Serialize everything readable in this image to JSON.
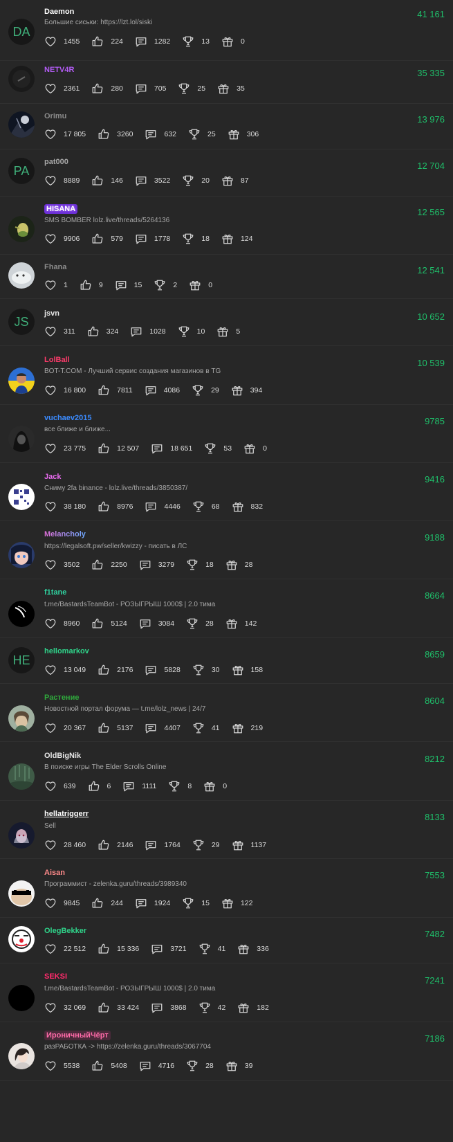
{
  "colors": {
    "background": "#272727",
    "score": "#1fbf6a",
    "status": "#a6a6a6"
  },
  "icons": {
    "likes": "heart-icon",
    "reactions": "thumbs-up-icon",
    "messages": "comment-icon",
    "trophies": "trophy-icon",
    "gifts": "gift-icon"
  },
  "users": [
    {
      "name": "Daemon",
      "name_color": "#ffffff",
      "avatar_letters": "DA",
      "status": "Большие сиськи: https://lzt.lol/siski",
      "stats": [
        "1455",
        "224",
        "1282",
        "13",
        "0"
      ],
      "score": "41 161"
    },
    {
      "name": "NETV4R",
      "name_color": "#b35cf5",
      "avatar_letters": "",
      "status": "",
      "stats": [
        "2361",
        "280",
        "705",
        "25",
        "35"
      ],
      "score": "35 335"
    },
    {
      "name": "Orimu",
      "name_color": "#8b8b8b",
      "avatar_letters": "",
      "status": "",
      "stats": [
        "17 805",
        "3260",
        "632",
        "25",
        "306"
      ],
      "score": "13 976"
    },
    {
      "name": "pat000",
      "name_color": "#a8a8a8",
      "avatar_letters": "PA",
      "status": "",
      "stats": [
        "8889",
        "146",
        "3522",
        "20",
        "87"
      ],
      "score": "12 704"
    },
    {
      "name": "HISANA",
      "name_color": "#ffffff",
      "avatar_letters": "",
      "status": "SMS BOMBER lolz.live/threads/5264136",
      "stats": [
        "9906",
        "579",
        "1778",
        "18",
        "124"
      ],
      "score": "12 565"
    },
    {
      "name": "Fhana",
      "name_color": "#8b8b8b",
      "avatar_letters": "",
      "status": "",
      "stats": [
        "1",
        "9",
        "15",
        "2",
        "0"
      ],
      "score": "12 541"
    },
    {
      "name": "jsvn",
      "name_color": "#e6e6e6",
      "avatar_letters": "JS",
      "status": "",
      "stats": [
        "311",
        "324",
        "1028",
        "10",
        "5"
      ],
      "score": "10 652"
    },
    {
      "name": "LolBall",
      "name_color": "#ff3b6b",
      "avatar_letters": "",
      "status": "BOT-T.COM - Лучший сервис создания магазинов в TG",
      "stats": [
        "16 800",
        "7811",
        "4086",
        "29",
        "394"
      ],
      "score": "10 539"
    },
    {
      "name": "vuchaev2015",
      "name_color": "#3b8bff",
      "avatar_letters": "",
      "status": "все ближе и ближе...",
      "stats": [
        "23 775",
        "12 507",
        "18 651",
        "53",
        "0"
      ],
      "score": "9785"
    },
    {
      "name": "Jack",
      "name_color": "#e86bef",
      "avatar_letters": "",
      "status": "Сниму 2fa binance - lolz.live/threads/3850387/",
      "stats": [
        "38 180",
        "8976",
        "4446",
        "68",
        "832"
      ],
      "score": "9416"
    },
    {
      "name": "Melancholy",
      "name_color": "#e06fd8",
      "avatar_letters": "",
      "status": "https://legalsoft.pw/seller/kwizzy - писать в ЛС",
      "stats": [
        "3502",
        "2250",
        "3279",
        "18",
        "28"
      ],
      "score": "9188"
    },
    {
      "name": "f1tane",
      "name_color": "#2fd3a0",
      "avatar_letters": "",
      "status": "t.me/BastardsTeamBot - РОЗЫГРЫШ 1000$ | 2.0 тима",
      "stats": [
        "8960",
        "5124",
        "3084",
        "28",
        "142"
      ],
      "score": "8664"
    },
    {
      "name": "hellomarkov",
      "name_color": "#2fd38a",
      "avatar_letters": "HE",
      "status": "",
      "stats": [
        "13 049",
        "2176",
        "5828",
        "30",
        "158"
      ],
      "score": "8659"
    },
    {
      "name": "Растение",
      "name_color": "#2faa3c",
      "avatar_letters": "",
      "status": "Новостной портал форума — t.me/lolz_news | 24/7",
      "stats": [
        "20 367",
        "5137",
        "4407",
        "41",
        "219"
      ],
      "score": "8604"
    },
    {
      "name": "OldBigNik",
      "name_color": "#e6e6e6",
      "avatar_letters": "",
      "status": "В поиске игры The Elder Scrolls Online",
      "stats": [
        "639",
        "6",
        "1111",
        "8",
        "0"
      ],
      "score": "8212"
    },
    {
      "name": "hellatriggerr",
      "name_color": "#ffffff",
      "avatar_letters": "",
      "status": "Sell",
      "stats": [
        "28 460",
        "2146",
        "1764",
        "29",
        "1137"
      ],
      "score": "8133"
    },
    {
      "name": "Aisan",
      "name_color": "#ff8a8a",
      "avatar_letters": "",
      "status": "Программист - zelenka.guru/threads/3989340",
      "stats": [
        "9845",
        "244",
        "1924",
        "15",
        "122"
      ],
      "score": "7553"
    },
    {
      "name": "OlegBekker",
      "name_color": "#2fd38a",
      "avatar_letters": "",
      "status": "",
      "stats": [
        "22 512",
        "15 336",
        "3721",
        "41",
        "336"
      ],
      "score": "7482"
    },
    {
      "name": "SEKSI",
      "name_color": "#ff2a6b",
      "avatar_letters": "",
      "status": "t.me/BastardsTeamBot - РОЗЫГРЫШ 1000$ | 2.0 тима",
      "stats": [
        "32 069",
        "33 424",
        "3868",
        "42",
        "182"
      ],
      "score": "7241"
    },
    {
      "name": "ИроничныйЧёрт",
      "name_color": "#ff6aa8",
      "avatar_letters": "",
      "status": "разРАБОТКА -> https://zelenka.guru/threads/3067704",
      "stats": [
        "5538",
        "5408",
        "4716",
        "28",
        "39"
      ],
      "score": "7186"
    }
  ]
}
